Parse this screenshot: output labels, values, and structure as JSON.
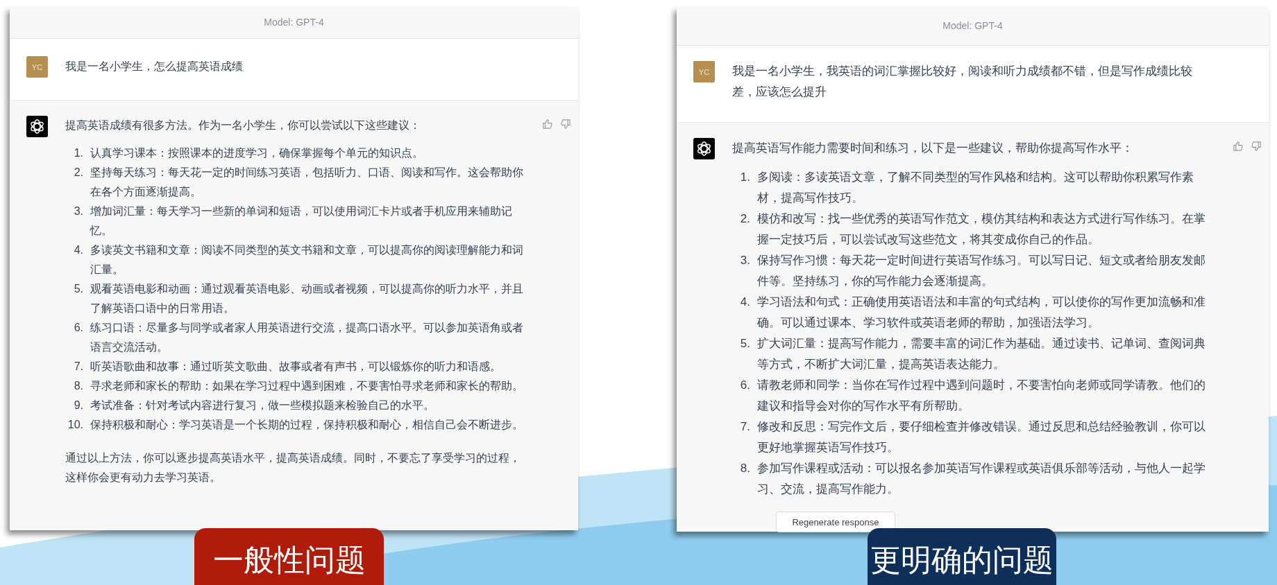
{
  "conversations": [
    {
      "model_label": "Model: GPT-4",
      "user": {
        "avatar": "YC",
        "message": "我是一名小学生，怎么提高英语成绩"
      },
      "assistant": {
        "intro": "提高英语成绩有很多方法。作为一名小学生，你可以尝试以下这些建议：",
        "items": [
          {
            "number": "1.",
            "text": "认真学习课本：按照课本的进度学习，确保掌握每个单元的知识点。"
          },
          {
            "number": "2.",
            "text": "坚持每天练习：每天花一定的时间练习英语，包括听力、口语、阅读和写作。这会帮助你在各个方面逐渐提高。"
          },
          {
            "number": "3.",
            "text": "增加词汇量：每天学习一些新的单词和短语，可以使用词汇卡片或者手机应用来辅助记忆。"
          },
          {
            "number": "4.",
            "text": "多读英文书籍和文章：阅读不同类型的英文书籍和文章，可以提高你的阅读理解能力和词汇量。"
          },
          {
            "number": "5.",
            "text": "观看英语电影和动画：通过观看英语电影、动画或者视频，可以提高你的听力水平，并且了解英语口语中的日常用语。"
          },
          {
            "number": "6.",
            "text": "练习口语：尽量多与同学或者家人用英语进行交流，提高口语水平。可以参加英语角或者语言交流活动。"
          },
          {
            "number": "7.",
            "text": "听英语歌曲和故事：通过听英文歌曲、故事或者有声书，可以锻炼你的听力和语感。"
          },
          {
            "number": "8.",
            "text": "寻求老师和家长的帮助：如果在学习过程中遇到困难，不要害怕寻求老师和家长的帮助。"
          },
          {
            "number": "9.",
            "text": "考试准备：针对考试内容进行复习，做一些模拟题来检验自己的水平。"
          },
          {
            "number": "10.",
            "text": "保持积极和耐心：学习英语是一个长期的过程，保持积极和耐心，相信自己会不断进步。"
          }
        ],
        "closing": "通过以上方法，你可以逐步提高英语水平，提高英语成绩。同时，不要忘了享受学习的过程，这样你会更有动力去学习英语。"
      },
      "caption": {
        "text": "一般性问题",
        "color": "#b01b0a"
      }
    },
    {
      "model_label": "Model: GPT-4",
      "user": {
        "avatar": "YC",
        "message": "我是一名小学生，我英语的词汇掌握比较好，阅读和听力成绩都不错，但是写作成绩比较差，应该怎么提升"
      },
      "assistant": {
        "intro": "提高英语写作能力需要时间和练习，以下是一些建议，帮助你提高写作水平：",
        "items": [
          {
            "number": "1.",
            "text": "多阅读：多读英语文章，了解不同类型的写作风格和结构。这可以帮助你积累写作素材，提高写作技巧。"
          },
          {
            "number": "2.",
            "text": "模仿和改写：找一些优秀的英语写作范文，模仿其结构和表达方式进行写作练习。在掌握一定技巧后，可以尝试改写这些范文，将其变成你自己的作品。"
          },
          {
            "number": "3.",
            "text": "保持写作习惯：每天花一定时间进行英语写作练习。可以写日记、短文或者给朋友发邮件等。坚持练习，你的写作能力会逐渐提高。"
          },
          {
            "number": "4.",
            "text": "学习语法和句式：正确使用英语语法和丰富的句式结构，可以使你的写作更加流畅和准确。可以通过课本、学习软件或英语老师的帮助，加强语法学习。"
          },
          {
            "number": "5.",
            "text": "扩大词汇量：提高写作能力，需要丰富的词汇作为基础。通过读书、记单词、查阅词典等方式，不断扩大词汇量，提高英语表达能力。"
          },
          {
            "number": "6.",
            "text": "请教老师和同学：当你在写作过程中遇到问题时，不要害怕向老师或同学请教。他们的建议和指导会对你的写作水平有所帮助。"
          },
          {
            "number": "7.",
            "text": "修改和反思：写完作文后，要仔细检查并修改错误。通过反思和总结经验教训，你可以更好地掌握英语写作技巧。"
          },
          {
            "number": "8.",
            "text": "参加写作课程或活动：可以报名参加英语写作课程或英语俱乐部等活动，与他人一起学习、交流，提高写作能力。"
          }
        ]
      },
      "regenerate_button": "Regenerate response",
      "caption": {
        "text": "更明确的问题",
        "color": "#0d2f5a"
      }
    }
  ]
}
